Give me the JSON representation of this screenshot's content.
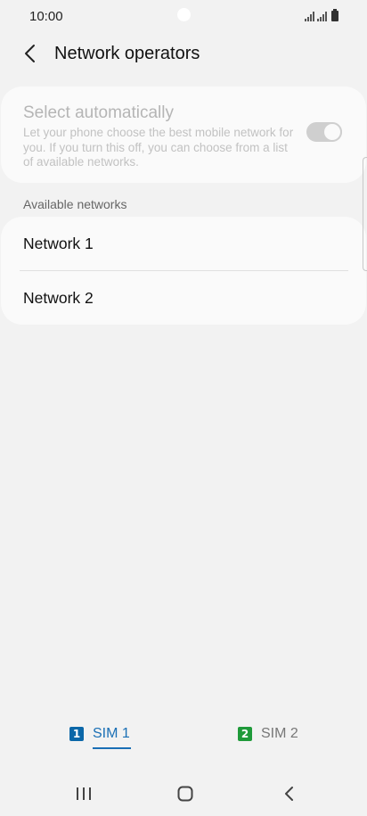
{
  "status_bar": {
    "time": "10:00",
    "icons": [
      "signal-icon",
      "signal-icon",
      "battery-icon"
    ]
  },
  "header": {
    "title": "Network operators",
    "back_icon": "chevron-left-icon"
  },
  "auto_select": {
    "title": "Select automatically",
    "description": "Let your phone choose the best mobile network for you. If you turn this off, you can choose from a list of available networks.",
    "toggle_on": true,
    "enabled": false
  },
  "available_networks": {
    "label": "Available networks",
    "items": [
      {
        "label": "Network 1"
      },
      {
        "label": "Network 2"
      }
    ]
  },
  "sim_tabs": [
    {
      "number": "1",
      "label": "SIM 1",
      "color": "#0b67a8",
      "active": true
    },
    {
      "number": "2",
      "label": "SIM 2",
      "color": "#1f9a3a",
      "active": false
    }
  ],
  "nav_bar": {
    "icons": [
      "recents-icon",
      "home-icon",
      "back-icon"
    ]
  },
  "colors": {
    "accent": "#1a6fb5",
    "background": "#f2f2f2",
    "card": "#fafafa"
  }
}
